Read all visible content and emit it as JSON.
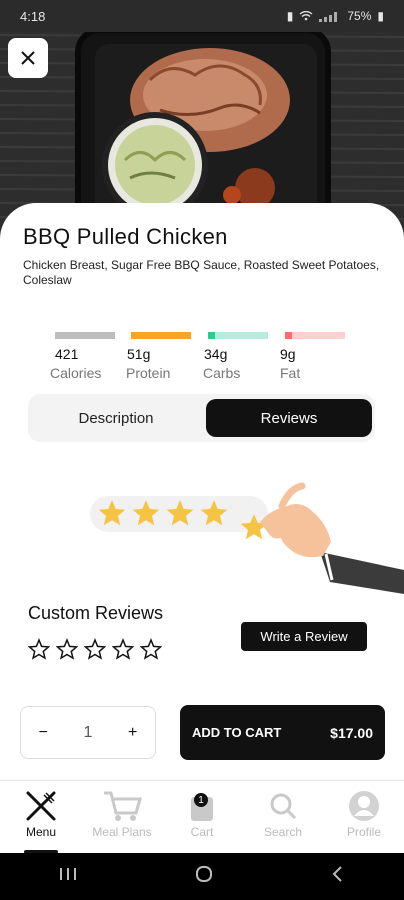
{
  "status": {
    "time": "4:18",
    "battery": "75%"
  },
  "product": {
    "title": "BBQ Pulled Chicken",
    "ingredients": "Chicken Breast, Sugar Free BBQ Sauce, Roasted Sweet Potatoes, Coleslaw",
    "price": "$17.00"
  },
  "macros": [
    {
      "value": "421",
      "label": "Calories",
      "color": "#bdbdbd",
      "fill": 1.0
    },
    {
      "value": "51g",
      "label": "Protein",
      "color": "#f5a623",
      "fill": 1.0
    },
    {
      "value": "34g",
      "label": "Carbs",
      "color": "#b7ebdd",
      "accent": "#2ecc8f",
      "fill": 0.12
    },
    {
      "value": "9g",
      "label": "Fat",
      "color": "#ffd0d0",
      "accent": "#ff6b6b",
      "fill": 0.12
    }
  ],
  "tabs": {
    "description": "Description",
    "reviews": "Reviews",
    "active": "Reviews"
  },
  "reviews": {
    "section_title": "Custom Reviews",
    "write_button": "Write a Review",
    "illustration_stars": 5,
    "user_rating_stars": 5
  },
  "quantity": {
    "minus": "−",
    "value": "1",
    "plus": "+"
  },
  "cart": {
    "label": "ADD TO CART"
  },
  "bottom_nav": [
    {
      "label": "Menu",
      "icon": "fork-knife-icon",
      "active": true
    },
    {
      "label": "Meal Plans",
      "icon": "cart-icon",
      "active": false
    },
    {
      "label": "Cart",
      "icon": "bag-icon",
      "badge": "1",
      "active": false
    },
    {
      "label": "Search",
      "icon": "search-icon",
      "active": false
    },
    {
      "label": "Profile",
      "icon": "profile-icon",
      "active": false
    }
  ],
  "colors": {
    "accent": "#111111",
    "star": "#f6c445"
  }
}
